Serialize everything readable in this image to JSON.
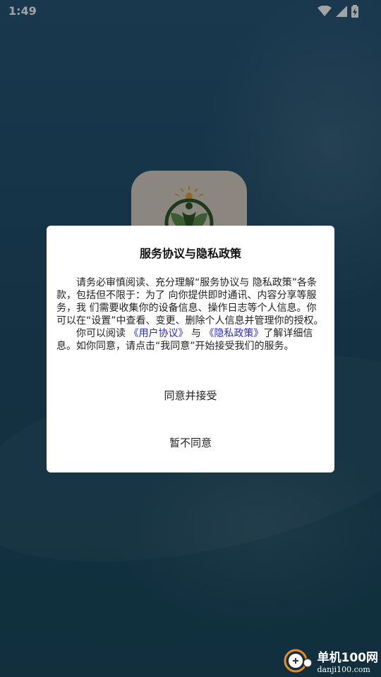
{
  "status_bar": {
    "time": "1:49",
    "icons": [
      "wifi-icon",
      "signal-icon",
      "battery-charging-icon"
    ]
  },
  "app_icon": {
    "name": "app-logo-icon",
    "colors": {
      "background": "#d9d3c9",
      "leaf": "#5d8f4e",
      "ring": "#2e5a2a",
      "sun": "#e2a53b"
    }
  },
  "dialog": {
    "title": "服务协议与隐私政策",
    "paragraph1": "请务必审慎阅读、充分理解“服务协议与 隐私政策”各条款，包括但不限于：为了 向你提供即时通讯、内容分享等服务，我 们需要收集你的设备信息、操作日志等个人信息。你可以在“设置”中查看、变更、删除个人信息并管理你的授权。",
    "paragraph2_prefix": "你可以阅读",
    "user_agreement_link": "《用户协议》",
    "and_text": "与",
    "privacy_policy_link": "《隐私政策》",
    "paragraph2_suffix": "了解详细信息。如你同意，请点击“我同意”开始接受我们的服务。",
    "agree_button": "同意并接受",
    "disagree_button": "暂不同意",
    "link_color": "#2b2bd6"
  },
  "watermark": {
    "name": "单机100网",
    "url": "danji100.com",
    "icon": "danji100-logo-icon"
  }
}
